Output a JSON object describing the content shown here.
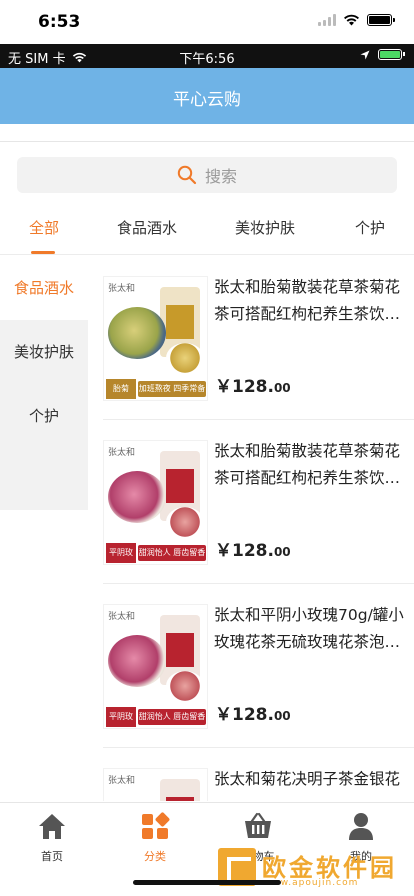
{
  "ios_status": {
    "time": "6:53"
  },
  "inner_status": {
    "carrier": "无 SIM 卡",
    "time": "下午6:56"
  },
  "nav": {
    "title": "平心云购"
  },
  "search": {
    "placeholder": "搜索"
  },
  "tabs": [
    {
      "label": "全部",
      "active": true
    },
    {
      "label": "食品酒水",
      "active": false
    },
    {
      "label": "美妆护肤",
      "active": false
    },
    {
      "label": "个护",
      "active": false
    }
  ],
  "sidebar": [
    {
      "label": "食品酒水",
      "active": true
    },
    {
      "label": "美妆护肤",
      "active": false
    },
    {
      "label": "个护",
      "active": false
    }
  ],
  "products": [
    {
      "name": "张太和胎菊散装花草茶菊花茶可搭配红枸杞养生茶饮…",
      "price_main": "￥128.",
      "price_cents": "00",
      "image": {
        "brand_mark": "张太和",
        "tag_main": "胎菊",
        "tag_slogan": "加班熬夜 四季常备",
        "theme": "#c79a2a"
      }
    },
    {
      "name": "张太和胎菊散装花草茶菊花茶可搭配红枸杞养生茶饮…",
      "price_main": "￥128.",
      "price_cents": "00",
      "image": {
        "brand_mark": "张太和",
        "tag_main": "平阴玫瑰",
        "tag_slogan": "甜润怡人 唇齿留香",
        "theme": "#b8232f"
      }
    },
    {
      "name": "张太和平阴小玫瑰70g/罐小玫瑰花茶无硫玫瑰花茶泡…",
      "price_main": "￥128.",
      "price_cents": "00",
      "image": {
        "brand_mark": "张太和",
        "tag_main": "平阴玫瑰",
        "tag_slogan": "甜润怡人 唇齿留香",
        "theme": "#b8232f"
      }
    },
    {
      "name": "张太和菊花决明子茶金银花",
      "price_main": "",
      "price_cents": "",
      "image": {
        "brand_mark": "张太和",
        "tag_main": "",
        "tag_slogan": "",
        "theme": "#b8232f"
      }
    }
  ],
  "tabbar": [
    {
      "label": "首页",
      "icon": "home-icon",
      "active": false
    },
    {
      "label": "分类",
      "icon": "category-icon",
      "active": true
    },
    {
      "label": "购物车",
      "icon": "cart-icon",
      "active": false
    },
    {
      "label": "我的",
      "icon": "user-icon",
      "active": false
    }
  ],
  "watermark": {
    "title": "欧金软件园",
    "url": "www.apoujin.com"
  },
  "colors": {
    "accent": "#f07a2a",
    "nav_bg": "#6fb3e6"
  }
}
